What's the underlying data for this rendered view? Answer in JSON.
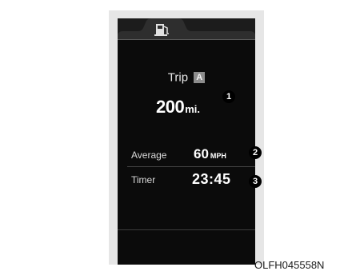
{
  "tab_bar": {
    "icon": "fuel-pump-icon"
  },
  "trip": {
    "label": "Trip",
    "badge": "A",
    "distance_value": "200",
    "distance_unit": "mi."
  },
  "stats": {
    "average_label": "Average",
    "average_value": "60",
    "average_unit": "MPH",
    "timer_label": "Timer",
    "timer_value": "23:45"
  },
  "markers": [
    "1",
    "2",
    "3"
  ],
  "caption": "OLFH045558N",
  "colors": {
    "display_background": "#0b0b0b",
    "tab_background": "#1c1c1c",
    "bezel": "#e6e6e6",
    "badge": "#8d8d8d",
    "marker": "#000000"
  }
}
